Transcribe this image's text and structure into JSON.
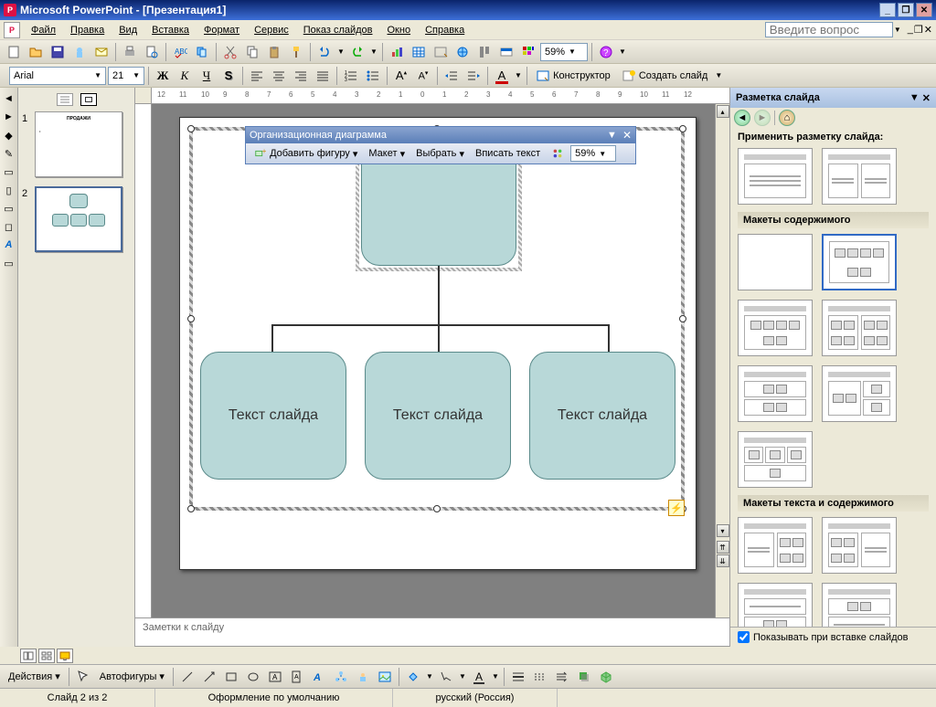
{
  "app": {
    "title": "Microsoft PowerPoint - [Презентация1]"
  },
  "menu": {
    "items": [
      "Файл",
      "Правка",
      "Вид",
      "Вставка",
      "Формат",
      "Сервис",
      "Показ слайдов",
      "Окно",
      "Справка"
    ],
    "ask_placeholder": "Введите вопрос"
  },
  "toolbar1": {
    "zoom": "59%"
  },
  "toolbar2": {
    "font": "Arial",
    "size": "21",
    "constructor": "Конструктор",
    "new_slide": "Создать слайд"
  },
  "ruler_marks": [
    "12",
    "11",
    "10",
    "9",
    "8",
    "7",
    "6",
    "5",
    "4",
    "3",
    "2",
    "1",
    "0",
    "1",
    "2",
    "3",
    "4",
    "5",
    "6",
    "7",
    "8",
    "9",
    "10",
    "11",
    "12"
  ],
  "thumbs": {
    "slide1_title": "ПРОДАЖИ",
    "slides": [
      1,
      2
    ]
  },
  "orgbar": {
    "title": "Организационная диаграмма",
    "add_shape": "Добавить фигуру",
    "layout": "Макет",
    "select": "Выбрать",
    "fit_text": "Вписать текст",
    "zoom": "59%"
  },
  "org": {
    "child_text": "Текст слайда"
  },
  "taskpane": {
    "title": "Разметка слайда",
    "apply": "Применить разметку слайда:",
    "sec_content": "Макеты содержимого",
    "sec_text_content": "Макеты текста и содержимого",
    "show_on_insert": "Показывать при вставке слайдов"
  },
  "notes": {
    "placeholder": "Заметки к слайду"
  },
  "bottom": {
    "actions": "Действия",
    "autoshapes": "Автофигуры"
  },
  "status": {
    "slide": "Слайд 2 из 2",
    "design": "Оформление по умолчанию",
    "lang": "русский (Россия)"
  }
}
